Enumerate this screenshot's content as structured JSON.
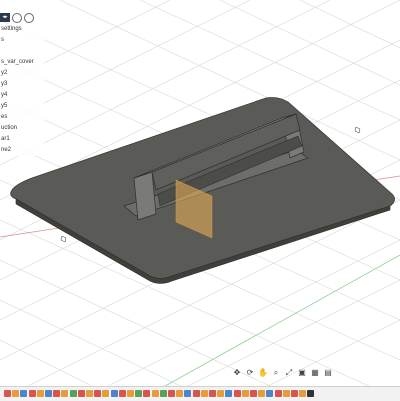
{
  "browser": {
    "items": [
      {
        "label": "settings"
      },
      {
        "label": "s"
      },
      {
        "label": ""
      },
      {
        "label": "s_var_cover"
      },
      {
        "label": "y2"
      },
      {
        "label": "y3"
      },
      {
        "label": "y4"
      },
      {
        "label": "y5"
      },
      {
        "label": "es"
      },
      {
        "label": "uction"
      },
      {
        "label": "ar1"
      },
      {
        "label": "ne2"
      }
    ]
  },
  "viewport": {
    "background": "#ffffff",
    "grid_color": "#d6d6d6",
    "plate_color": "#5c5c58"
  },
  "timeline": {
    "icons": [
      "sketch-icon",
      "extrude-icon",
      "fillet-icon",
      "sketch-icon",
      "extrude-icon",
      "chamfer-icon",
      "sketch-icon",
      "extrude-icon",
      "mirror-icon",
      "sketch-icon",
      "extrude-icon",
      "sketch-icon",
      "extrude-icon",
      "fillet-icon",
      "sketch-icon",
      "extrude-icon",
      "combine-icon",
      "sketch-icon",
      "extrude-icon",
      "pattern-icon",
      "sketch-icon",
      "extrude-icon",
      "fillet-icon",
      "sketch-icon",
      "extrude-icon",
      "sketch-icon",
      "extrude-icon",
      "chamfer-icon",
      "sketch-icon",
      "extrude-icon",
      "sketch-icon",
      "extrude-icon",
      "fillet-icon",
      "sketch-icon",
      "extrude-icon",
      "sketch-icon",
      "extrude-icon",
      "marker-icon"
    ]
  },
  "nav_icons": [
    "move-icon",
    "orbit-icon",
    "pan-icon",
    "zoom-icon",
    "fit-icon",
    "display-icon",
    "grid-icon",
    "viewports-icon"
  ]
}
